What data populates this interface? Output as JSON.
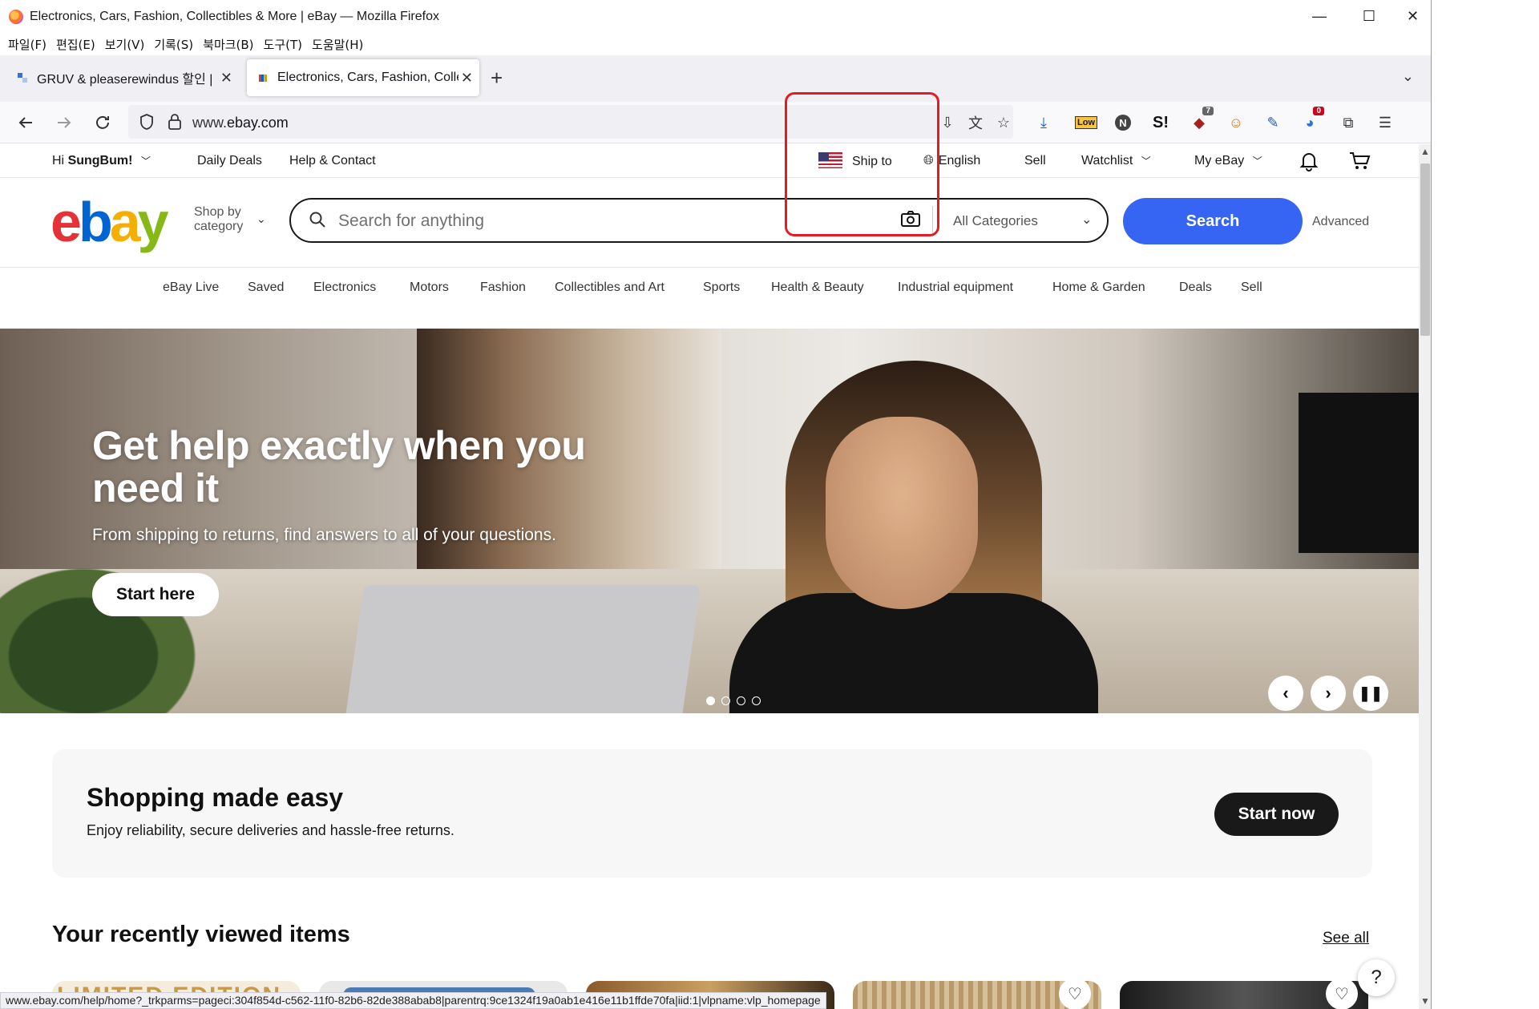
{
  "window": {
    "title": "Electronics, Cars, Fashion, Collectibles & More | eBay — Mozilla Firefox",
    "controls": {
      "minimize": "—",
      "maximize": "☐",
      "close": "✕"
    }
  },
  "menubar": [
    "파일(F)",
    "편집(E)",
    "보기(V)",
    "기록(S)",
    "북마크(B)",
    "도구(T)",
    "도움말(H)"
  ],
  "tabs": [
    {
      "label": "GRUV & pleaserewindus 할인 |",
      "active": false
    },
    {
      "label": "Electronics, Cars, Fashion, Collectibles",
      "active": true
    }
  ],
  "navbar": {
    "url_prefix": "www.",
    "url_domain": "ebay.com",
    "extensions": [
      {
        "icon": "save-to-pocket-icon"
      },
      {
        "icon": "translate-icon"
      },
      {
        "icon": "bookmark-star-icon"
      },
      {
        "icon": "download-icon"
      },
      {
        "icon": "low-price-extension-icon",
        "label": "Low"
      },
      {
        "icon": "n-extension-icon",
        "label": "N"
      },
      {
        "icon": "s-extension-icon",
        "label": "S!"
      },
      {
        "icon": "ublock-icon",
        "badge": "7"
      },
      {
        "icon": "monkey-extension-icon"
      },
      {
        "icon": "pencil-extension-icon"
      },
      {
        "icon": "droplet-extension-icon",
        "badge": "0"
      },
      {
        "icon": "extensions-puzzle-icon"
      },
      {
        "icon": "menu-icon"
      }
    ]
  },
  "ebay": {
    "topnav": {
      "greeting_prefix": "Hi ",
      "user": "SungBum!",
      "daily_deals": "Daily Deals",
      "help": "Help & Contact",
      "ship_to": "Ship to",
      "language": "English",
      "sell": "Sell",
      "watchlist": "Watchlist",
      "my_ebay": "My eBay"
    },
    "header": {
      "logo": {
        "e": "e",
        "b": "b",
        "a": "a",
        "y": "y"
      },
      "shop_by_1": "Shop by",
      "shop_by_2": "category",
      "search_placeholder": "Search for anything",
      "categories": "All Categories",
      "search_button": "Search",
      "advanced": "Advanced"
    },
    "categories": [
      "eBay Live",
      "Saved",
      "Electronics",
      "Motors",
      "Fashion",
      "Collectibles and Art",
      "Sports",
      "Health & Beauty",
      "Industrial equipment",
      "Home & Garden",
      "Deals",
      "Sell"
    ],
    "hero": {
      "headline": "Get help exactly when you need it",
      "subtext": "From shipping to returns, find answers to all of your questions.",
      "cta": "Start here",
      "active_slide": 1,
      "slide_count": 4
    },
    "promo": {
      "title": "Shopping made easy",
      "text": "Enjoy reliability, secure deliveries and hassle-free returns.",
      "button": "Start now"
    },
    "recently_viewed": {
      "title": "Your recently viewed items",
      "see_all": "See all",
      "first_item_text": "LIMITED EDITION"
    },
    "help_button": "?"
  },
  "status_url": "www.ebay.com/help/home?_trkparms=pageci:304f854d-c562-11f0-82b6-82de388abab8|parentrq:9ce1324f19a0ab1e416e11b1ffde70fa|iid:1|vlpname:vlp_homepage",
  "colors": {
    "ebay_red": "#e53238",
    "ebay_blue": "#0064d2",
    "ebay_yellow": "#f5af02",
    "ebay_green": "#86b817",
    "search_button": "#3665f3",
    "annotation": "#e31b23"
  }
}
